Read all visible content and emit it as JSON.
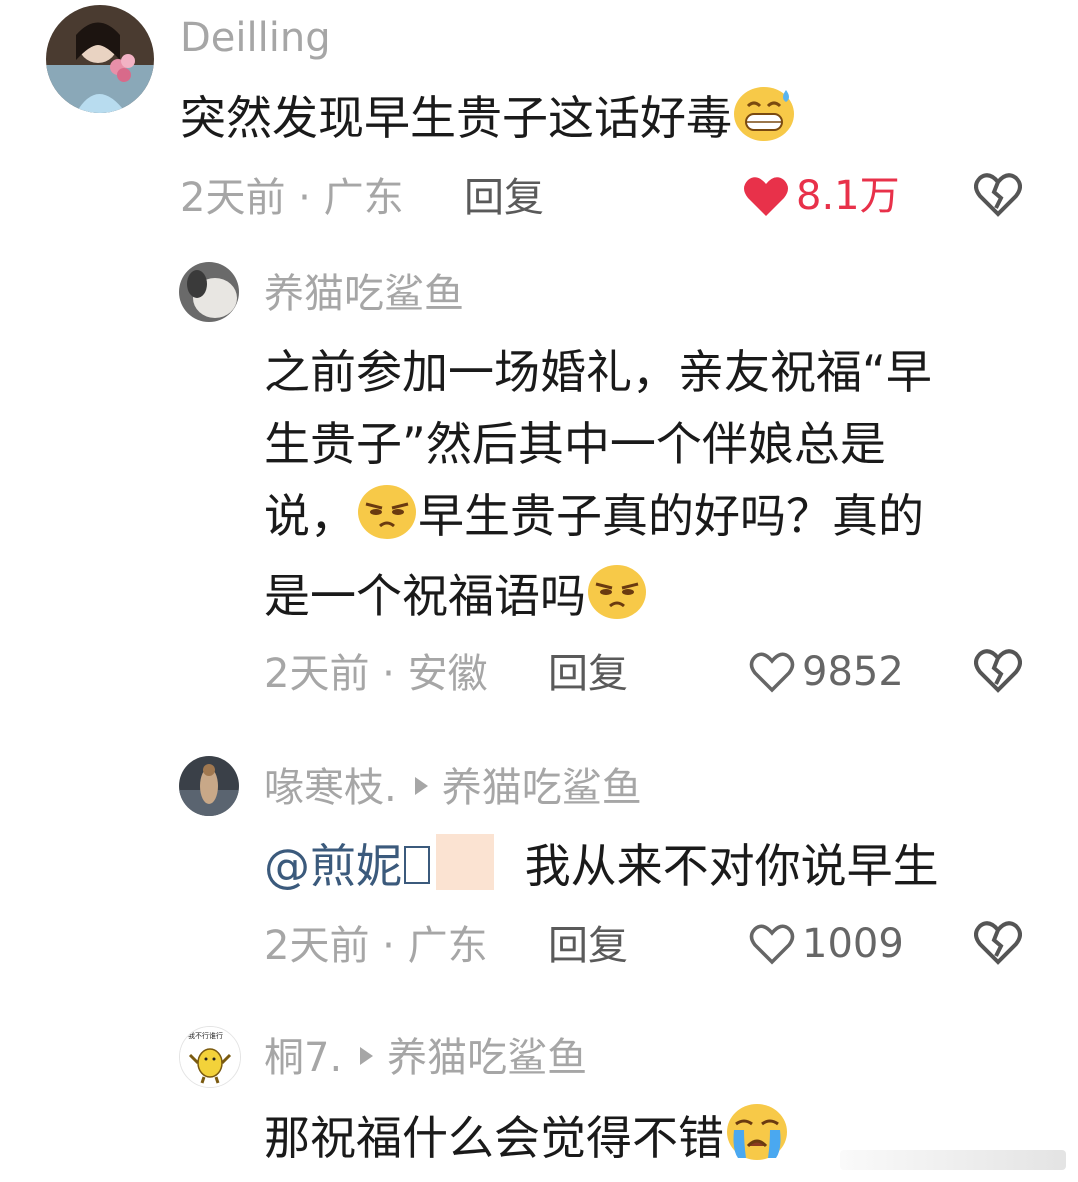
{
  "comments": [
    {
      "username": "Deilling",
      "text": "突然发现早生贵子这话好毒",
      "time": "2天前 · 广东",
      "reply": "回复",
      "likes": "8.1万",
      "liked": true
    },
    {
      "username": "养猫吃鲨鱼",
      "text_lines": [
        "之前参加一场婚礼，亲友祝福“早",
        "生贵子”然后其中一个伴娘总是"
      ],
      "text_line3_a": "说，",
      "text_line3_b": "早生贵子真的好吗？真的",
      "text_line4": "是一个祝福语吗",
      "time": "2天前 · 安徽",
      "reply": "回复",
      "likes": "9852",
      "liked": false
    },
    {
      "username": "喙寒枝.",
      "reply_to": "养猫吃鲨鱼",
      "mention": "@煎妮",
      "text": "我从来不对你说早生",
      "time": "2天前 · 广东",
      "reply": "回复",
      "likes": "1009",
      "liked": false
    },
    {
      "username": "桐7.",
      "reply_to": "养猫吃鲨鱼",
      "text": "那祝福什么会觉得不错",
      "avatar_caption": "我不行谁行"
    }
  ],
  "colors": {
    "meta_gray": "#a6a6a6",
    "like_red": "#e8314a",
    "mention_blue": "#3b5a7c"
  }
}
